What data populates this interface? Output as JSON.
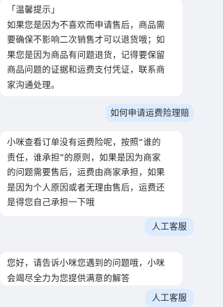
{
  "messages": [
    {
      "role": "bot",
      "lines": [
        "「温馨提示」",
        "如果您是因为不喜欢而申请售后，商品需",
        "要确保不影响二次销售才可以退货哦；如",
        "果您是因为商品有问题退货，记得要保留",
        "商品问题的证据和运费支付凭证，联系商",
        "家沟通处理。"
      ]
    },
    {
      "role": "user",
      "text": "如何申请运费险理赔"
    },
    {
      "role": "bot",
      "lines": [
        "小咪查看订单没有运费险呢，按照“谁的",
        "责任，谁承担”的原则，如果是因为商家",
        "的问题需要售后，运费由商家承担，如果",
        "是因为个人原因或者无理由售后，运费还",
        "是得您自己承担一下哦"
      ]
    },
    {
      "role": "user",
      "text": "人工客服"
    },
    {
      "role": "bot",
      "lines": [
        "您好，请告诉小咪您遇到的问题哦，小咪",
        "会竭尽全力为您提供满意的解答"
      ]
    },
    {
      "role": "user",
      "text": "人工客服"
    }
  ]
}
